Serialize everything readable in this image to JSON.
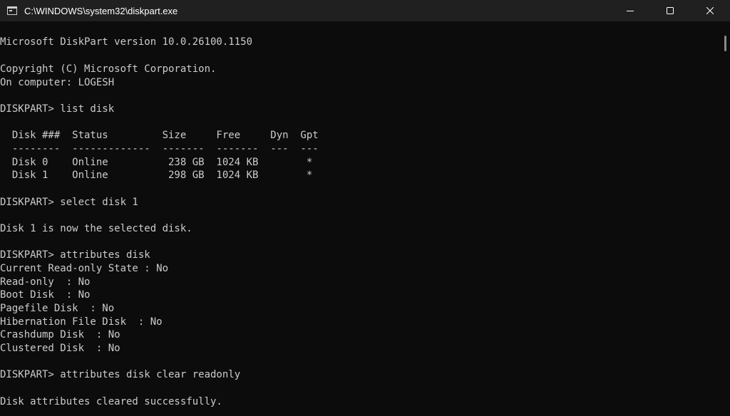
{
  "window": {
    "title": "C:\\WINDOWS\\system32\\diskpart.exe"
  },
  "controls": {
    "minimize_icon": "minimize-icon",
    "maximize_icon": "maximize-icon",
    "close_icon": "close-icon"
  },
  "console": {
    "lines": [
      "Microsoft DiskPart version 10.0.26100.1150",
      "Copyright (C) Microsoft Corporation.",
      "On computer: LOGESH",
      "DISKPART> list disk",
      "  Disk ###  Status         Size     Free     Dyn  Gpt",
      "  --------  -------------  -------  -------  ---  ---",
      "  Disk 0    Online          238 GB  1024 KB        *",
      "  Disk 1    Online          298 GB  1024 KB        *",
      "DISKPART> select disk 1",
      "Disk 1 is now the selected disk.",
      "DISKPART> attributes disk",
      "Current Read-only State : No",
      "Read-only  : No",
      "Boot Disk  : No",
      "Pagefile Disk  : No",
      "Hibernation File Disk  : No",
      "Crashdump Disk  : No",
      "Clustered Disk  : No",
      "DISKPART> attributes disk clear readonly",
      "Disk attributes cleared successfully."
    ]
  }
}
